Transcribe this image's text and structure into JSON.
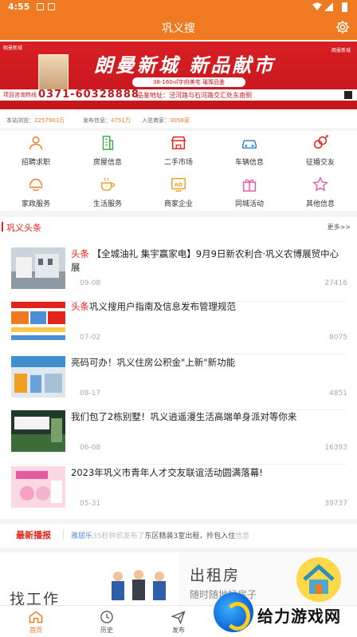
{
  "status_bar": {
    "time": "4:55"
  },
  "header": {
    "title": "巩义搜"
  },
  "banner": {
    "logo": "朗曼新城",
    "slogan": "朗曼新城 新品献市",
    "subline": "38-160㎡宇府美宅 璀璨品鉴",
    "hotline_label": "项目咨询热线",
    "hotline": "0371-60328888",
    "address": "品鉴地址：泾河路与石河路交汇处东南侧",
    "brand_right": "朗曼新城"
  },
  "stats": {
    "visits_label": "本站浏览：",
    "visits": "2257903万",
    "posts_label": "发布信息：",
    "posts": "4751万",
    "merchants_label": "入驻商家：",
    "merchants": "3058家"
  },
  "categories": [
    {
      "label": "招聘求职",
      "icon": "person-icon"
    },
    {
      "label": "房屋信息",
      "icon": "building-icon"
    },
    {
      "label": "二手市场",
      "icon": "store-icon"
    },
    {
      "label": "车辆信息",
      "icon": "car-icon"
    },
    {
      "label": "征婚交友",
      "icon": "gender-icon"
    },
    {
      "label": "家政服务",
      "icon": "home-service-icon"
    },
    {
      "label": "生活服务",
      "icon": "coffee-icon"
    },
    {
      "label": "商家企业",
      "icon": "ad-icon"
    },
    {
      "label": "同城活动",
      "icon": "gift-icon"
    },
    {
      "label": "其他信息",
      "icon": "star-icon"
    }
  ],
  "headlines": {
    "title": "巩义头条",
    "more": "更多>>",
    "items": [
      {
        "tag": "头条",
        "title": "【全城油礼 集宇赢家电】9月9日新农利合·巩义农博展贸中心展",
        "date": "09-08",
        "views": "27416"
      },
      {
        "tag": "头条",
        "title": "巩义搜用户指南及信息发布管理规范",
        "date": "07-02",
        "views": "8075"
      },
      {
        "tag": "",
        "title": "亮码可办！巩义住房公积金\"上新\"新功能",
        "date": "08-17",
        "views": "4851"
      },
      {
        "tag": "",
        "title": "我们包了2栋别墅！巩义逍遥漫生活高端单身派对等你来",
        "date": "06-08",
        "views": "16393"
      },
      {
        "tag": "",
        "title": "2023年巩义市青年人才交友联谊活动圆满落幕!",
        "date": "05-31",
        "views": "39737"
      }
    ]
  },
  "latest": {
    "label": "最新播报",
    "user": "雅居乐",
    "time_text": "35秒钟前发布了",
    "content": "东区精装3室出租，拎包入住",
    "trail": "信息"
  },
  "promos": {
    "left_title": "找工作",
    "right_title": "出租房",
    "right_sub": "随时随地找房子"
  },
  "tabs": [
    {
      "label": "首页",
      "icon": "home-icon",
      "active": true
    },
    {
      "label": "历史",
      "icon": "clock-icon",
      "active": false
    },
    {
      "label": "发布",
      "icon": "send-icon",
      "active": false
    }
  ],
  "watermark": {
    "text": "给力游戏网"
  },
  "colors": {
    "primary": "#f07a22",
    "accent_red": "#e2241a"
  }
}
